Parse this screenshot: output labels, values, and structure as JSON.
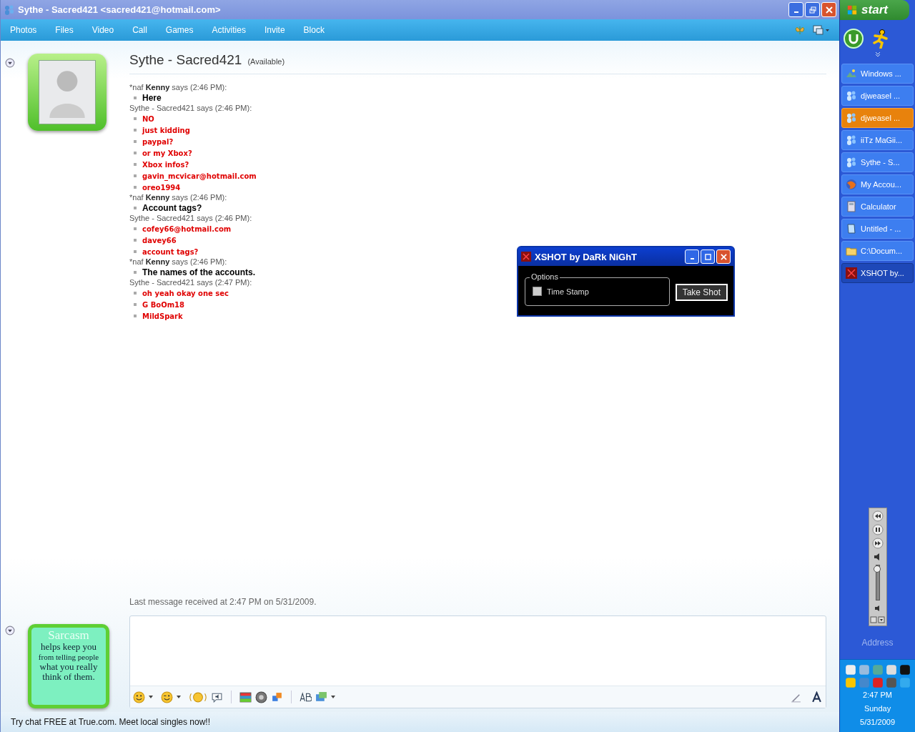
{
  "window": {
    "title": "Sythe - Sacred421 <sacred421@hotmail.com>"
  },
  "menu": [
    "Photos",
    "Files",
    "Video",
    "Call",
    "Games",
    "Activities",
    "Invite",
    "Block"
  ],
  "contact": {
    "name": "Sythe - Sacred421",
    "status": "(Available)"
  },
  "messages": [
    {
      "kind": "contact",
      "header": "*naf **Kenny** says (2:46 PM):",
      "lines": [
        "Here"
      ]
    },
    {
      "kind": "self",
      "header": "Sythe - Sacred421 says (2:46 PM):",
      "lines": [
        "NO",
        "just kidding",
        "paypal?",
        "or my Xbox?",
        "Xbox infos?",
        "gavin_mcvicar@hotmail.com",
        "oreo1994"
      ]
    },
    {
      "kind": "contact",
      "header": "*naf **Kenny** says (2:46 PM):",
      "lines": [
        "Account tags?"
      ]
    },
    {
      "kind": "self",
      "header": "Sythe - Sacred421 says (2:46 PM):",
      "lines": [
        "cofey66@hotmail.com",
        "davey66",
        "account tags?"
      ]
    },
    {
      "kind": "contact",
      "header": "*naf **Kenny** says (2:46 PM):",
      "lines": [
        "The names of the accounts."
      ]
    },
    {
      "kind": "self",
      "header": "Sythe - Sacred421 says (2:47 PM):",
      "lines": [
        "oh yeah okay one sec",
        "G BoOm18",
        "MildSpark"
      ]
    }
  ],
  "last_message": "Last message received at 2:47 PM on 5/31/2009.",
  "my_picture": {
    "heading": "Sarcasm",
    "lines": [
      "helps keep you",
      "from telling people",
      "what you really",
      "think of them."
    ]
  },
  "ad": "Try chat FREE at True.com. Meet local singles now!!",
  "dialog": {
    "title": "XSHOT by DaRk NiGhT",
    "group_label": "Options",
    "checkbox": {
      "label": "Time Stamp",
      "checked": false
    },
    "button": "Take Shot"
  },
  "taskbar": {
    "start": "start",
    "tasks": [
      {
        "kind": "photo",
        "label": "Windows ...",
        "flashing": false,
        "selected": false
      },
      {
        "kind": "messenger",
        "label": "djweasel ...",
        "flashing": false,
        "selected": false
      },
      {
        "kind": "messenger",
        "label": "djweasel ...",
        "flashing": true,
        "selected": false
      },
      {
        "kind": "messenger",
        "label": "iiTz MaGii...",
        "flashing": false,
        "selected": false
      },
      {
        "kind": "messenger",
        "label": "Sythe - S...",
        "flashing": false,
        "selected": false
      },
      {
        "kind": "browser",
        "label": "My Accou...",
        "flashing": false,
        "selected": false
      },
      {
        "kind": "calculator",
        "label": "Calculator",
        "flashing": false,
        "selected": false
      },
      {
        "kind": "notepad",
        "label": "Untitled - ...",
        "flashing": false,
        "selected": false
      },
      {
        "kind": "folder",
        "label": "C:\\Docum...",
        "flashing": false,
        "selected": false
      },
      {
        "kind": "screenshot",
        "label": "XSHOT by...",
        "flashing": false,
        "selected": true
      }
    ],
    "volume": {
      "level": 1
    },
    "address": "Address",
    "clock": {
      "time": "2:47 PM",
      "day": "Sunday",
      "date": "5/31/2009"
    }
  }
}
